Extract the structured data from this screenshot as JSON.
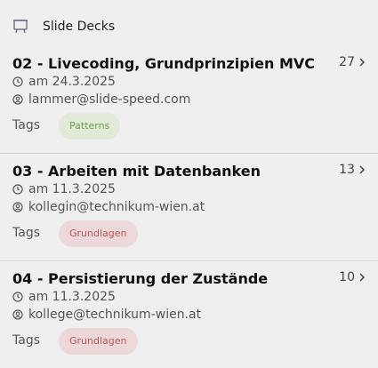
{
  "header": {
    "title": "Slide Decks",
    "icon": "presentation-board-icon"
  },
  "decks": [
    {
      "title": "02 - Livecoding, Grundprinzipien MVC",
      "count": "27",
      "date": "am 24.3.2025",
      "author": "lammer@slide-speed.com",
      "tags_label": "Tags",
      "tag": "Patterns"
    },
    {
      "title": "03 - Arbeiten mit Datenbanken",
      "count": "13",
      "date": "am 11.3.2025",
      "author": "kollegin@technikum-wien.at",
      "tags_label": "Tags",
      "tag": "Grundlagen"
    },
    {
      "title": "04 - Persistierung der Zustände",
      "count": "10",
      "date": "am 11.3.2025",
      "author": "kollege@technikum-wien.at",
      "tags_label": "Tags",
      "tag": "Grundlagen"
    }
  ],
  "colors": {
    "background": "#efefef",
    "tag_green_bg": "#e0ead7",
    "tag_green_text": "#6aa34a",
    "tag_red_bg": "#ecd8d8",
    "tag_red_text": "#c0565a"
  }
}
